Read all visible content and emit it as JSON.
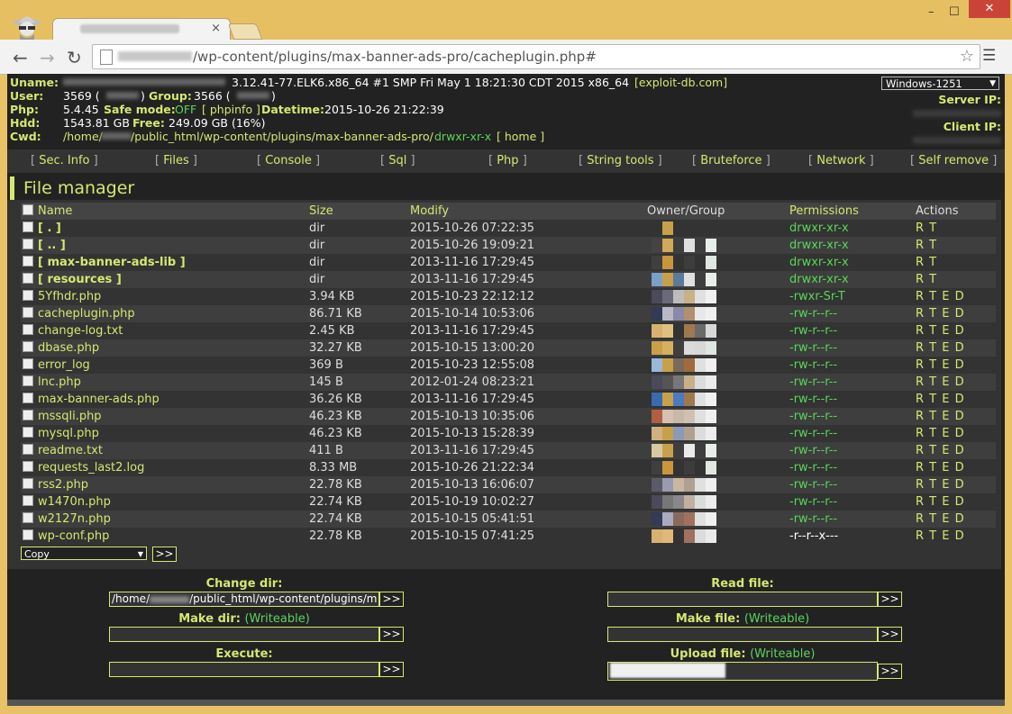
{
  "browser": {
    "url_path": "/wp-content/plugins/max-banner-ads-pro/cacheplugin.php#",
    "tab_close": "×",
    "minimize": "–",
    "maximize": "☐",
    "close": "✕"
  },
  "header": {
    "uname_label": "Uname:",
    "uname_value": "3.12.41-77.ELK6.x86_64 #1 SMP Fri May 1 18:21:30 CDT 2015 x86_64",
    "uname_link": "[exploit-db.com]",
    "user_label": "User:",
    "user_value": "3569 (",
    "group_label": "Group:",
    "group_value": "3566 (",
    "close_paren": ")",
    "php_label": "Php:",
    "php_value": "5.4.45",
    "safemode_label": "Safe mode:",
    "safemode_value": "OFF",
    "phpinfo_link": "[ phpinfo ]",
    "datetime_label": "Datetime:",
    "datetime_value": "2015-10-26 21:22:39",
    "hdd_label": "Hdd:",
    "hdd_value": "1543.81 GB",
    "free_label": "Free:",
    "free_value": "249.09 GB (16%)",
    "cwd_label": "Cwd:",
    "cwd_prefix": "/home/",
    "cwd_value": "/public_html/wp-content/plugins/max-banner-ads-pro/",
    "cwd_perms": "drwxr-xr-x",
    "home_link": "[ home ]",
    "encoding": "Windows-1251",
    "server_ip_label": "Server IP:",
    "client_ip_label": "Client IP:"
  },
  "menu": [
    {
      "label": "Sec. Info"
    },
    {
      "label": "Files"
    },
    {
      "label": "Console"
    },
    {
      "label": "Sql"
    },
    {
      "label": "Php"
    },
    {
      "label": "String tools"
    },
    {
      "label": "Bruteforce"
    },
    {
      "label": "Network"
    },
    {
      "label": "Self remove"
    }
  ],
  "file_manager": {
    "title": "File manager",
    "columns": [
      "Name",
      "Size",
      "Modify",
      "Owner/Group",
      "Permissions",
      "Actions"
    ],
    "rows": [
      {
        "name": "[ . ]",
        "type": "dir",
        "size": "dir",
        "modify": "2015-10-26 07:22:35",
        "perms": "drwxr-xr-x",
        "actions": "R T"
      },
      {
        "name": "[ .. ]",
        "type": "dir",
        "size": "dir",
        "modify": "2015-10-26 19:09:21",
        "perms": "drwxr-xr-x",
        "actions": "R T"
      },
      {
        "name": "[ max-banner-ads-lib ]",
        "type": "dir",
        "size": "dir",
        "modify": "2013-11-16 17:29:45",
        "perms": "drwxr-xr-x",
        "actions": "R T"
      },
      {
        "name": "[ resources ]",
        "type": "dir",
        "size": "dir",
        "modify": "2013-11-16 17:29:45",
        "perms": "drwxr-xr-x",
        "actions": "R T"
      },
      {
        "name": "5Yfhdr.php",
        "type": "file",
        "size": "3.94 KB",
        "modify": "2015-10-23 22:12:12",
        "perms": "-rwxr-Sr-T",
        "actions": "R T E D"
      },
      {
        "name": "cacheplugin.php",
        "type": "file",
        "size": "86.71 KB",
        "modify": "2015-10-14 10:53:06",
        "perms": "-rw-r--r--",
        "actions": "R T E D"
      },
      {
        "name": "change-log.txt",
        "type": "file",
        "size": "2.45 KB",
        "modify": "2013-11-16 17:29:45",
        "perms": "-rw-r--r--",
        "actions": "R T E D"
      },
      {
        "name": "dbase.php",
        "type": "file",
        "size": "32.27 KB",
        "modify": "2015-10-15 13:00:20",
        "perms": "-rw-r--r--",
        "actions": "R T E D"
      },
      {
        "name": "error_log",
        "type": "file",
        "size": "369 B",
        "modify": "2015-10-23 12:55:08",
        "perms": "-rw-r--r--",
        "actions": "R T E D"
      },
      {
        "name": "lnc.php",
        "type": "file",
        "size": "145 B",
        "modify": "2012-01-24 08:23:21",
        "perms": "-rw-r--r--",
        "actions": "R T E D"
      },
      {
        "name": "max-banner-ads.php",
        "type": "file",
        "size": "36.26 KB",
        "modify": "2013-11-16 17:29:45",
        "perms": "-rw-r--r--",
        "actions": "R T E D"
      },
      {
        "name": "mssqli.php",
        "type": "file",
        "size": "46.23 KB",
        "modify": "2015-10-13 10:35:06",
        "perms": "-rw-r--r--",
        "actions": "R T E D"
      },
      {
        "name": "mysql.php",
        "type": "file",
        "size": "46.23 KB",
        "modify": "2015-10-13 15:28:39",
        "perms": "-rw-r--r--",
        "actions": "R T E D"
      },
      {
        "name": "readme.txt",
        "type": "file",
        "size": "411 B",
        "modify": "2013-11-16 17:29:45",
        "perms": "-rw-r--r--",
        "actions": "R T E D"
      },
      {
        "name": "requests_last2.log",
        "type": "file",
        "size": "8.33 MB",
        "modify": "2015-10-26 21:22:34",
        "perms": "-rw-r--r--",
        "actions": "R T E D"
      },
      {
        "name": "rss2.php",
        "type": "file",
        "size": "22.78 KB",
        "modify": "2015-10-13 16:06:07",
        "perms": "-rw-r--r--",
        "actions": "R T E D"
      },
      {
        "name": "w1470n.php",
        "type": "file",
        "size": "22.74 KB",
        "modify": "2015-10-19 10:02:27",
        "perms": "-rw-r--r--",
        "actions": "R T E D"
      },
      {
        "name": "w2127n.php",
        "type": "file",
        "size": "22.74 KB",
        "modify": "2015-10-15 05:41:51",
        "perms": "-rw-r--r--",
        "actions": "R T E D"
      },
      {
        "name": "wp-conf.php",
        "type": "file",
        "size": "22.78 KB",
        "modify": "2015-10-15 07:41:25",
        "perms": "-r--r--x---",
        "actions": "R T E D"
      }
    ],
    "bulk_action": "Copy",
    "go_label": ">>"
  },
  "tools": {
    "change_dir_label": "Change dir:",
    "change_dir_prefix": "/home/",
    "change_dir_value": "/public_html/wp-content/plugins/m",
    "read_file_label": "Read file:",
    "make_dir_label": "Make dir:",
    "make_file_label": "Make file:",
    "writeable": "(Writeable)",
    "execute_label": "Execute:",
    "upload_file_label": "Upload file:",
    "go_label": ">>"
  },
  "colors": {
    "accent": "#d4e870",
    "green": "#5bd55b",
    "background": "#222222"
  }
}
